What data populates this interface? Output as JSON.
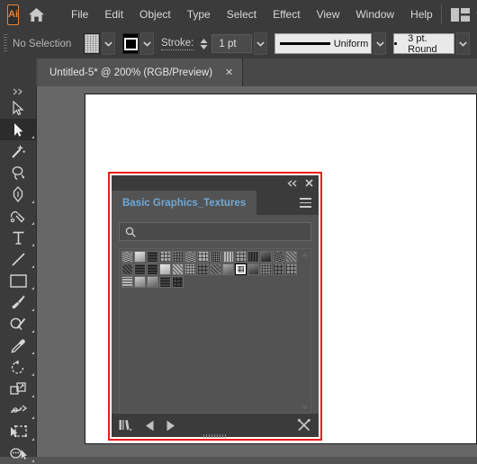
{
  "app": {
    "name": "Ai",
    "logo_color": "#e8833a",
    "home_icon": "home-icon",
    "workspace_icon": "workspace-switcher-icon"
  },
  "menubar": {
    "items": [
      {
        "label": "File"
      },
      {
        "label": "Edit"
      },
      {
        "label": "Object"
      },
      {
        "label": "Type"
      },
      {
        "label": "Select"
      },
      {
        "label": "Effect"
      },
      {
        "label": "View"
      },
      {
        "label": "Window"
      },
      {
        "label": "Help"
      }
    ]
  },
  "controlbar": {
    "selection_status": "No Selection",
    "fill_swatch": "noise-texture-swatch",
    "stroke_swatch": "stroke-color-swatch",
    "stroke_label": "Stroke:",
    "stroke_weight": "1 pt",
    "stroke_profile": "Uniform",
    "brush_definition": "3 pt. Round",
    "dropdown_icon": "chevron-down-icon"
  },
  "tabbar": {
    "document_title": "Untitled-5* @ 200% (RGB/Preview)",
    "close_glyph": "✕"
  },
  "toolbar": {
    "tools": [
      {
        "name": "selection-tool",
        "active": false,
        "has_flyout": false
      },
      {
        "name": "direct-selection-tool",
        "active": true,
        "has_flyout": true
      },
      {
        "name": "magic-wand-tool",
        "active": false,
        "has_flyout": false
      },
      {
        "name": "lasso-tool",
        "active": false,
        "has_flyout": false
      },
      {
        "name": "pen-tool",
        "active": false,
        "has_flyout": true
      },
      {
        "name": "curvature-tool",
        "active": false,
        "has_flyout": false
      },
      {
        "name": "type-tool",
        "active": false,
        "has_flyout": true
      },
      {
        "name": "line-segment-tool",
        "active": false,
        "has_flyout": true
      },
      {
        "name": "rectangle-tool",
        "active": false,
        "has_flyout": true
      },
      {
        "name": "paintbrush-tool",
        "active": false,
        "has_flyout": true
      },
      {
        "name": "shaper-tool",
        "active": false,
        "has_flyout": true
      },
      {
        "name": "eyedropper-tool",
        "active": false,
        "has_flyout": true
      },
      {
        "name": "rotate-tool",
        "active": false,
        "has_flyout": true
      },
      {
        "name": "scale-tool",
        "active": false,
        "has_flyout": true
      },
      {
        "name": "width-tool",
        "active": false,
        "has_flyout": true
      },
      {
        "name": "free-transform-tool",
        "active": false,
        "has_flyout": true
      },
      {
        "name": "shape-builder-tool",
        "active": false,
        "has_flyout": true
      }
    ]
  },
  "panel": {
    "highlight_color": "#ee1c1c",
    "tab_label": "Basic Graphics_Textures",
    "tab_label_color": "#6fa8d8",
    "collapse_icon": "double-chevron-left-icon",
    "close_icon": "close-icon",
    "menu_icon": "panel-menu-icon",
    "search": {
      "icon": "search-icon",
      "value": "",
      "placeholder": ""
    },
    "swatches": {
      "columns": 14,
      "total": 33,
      "selected_index": 23,
      "items": [
        {
          "name": "texture-swatch-1"
        },
        {
          "name": "texture-swatch-2"
        },
        {
          "name": "texture-swatch-3"
        },
        {
          "name": "texture-swatch-4"
        },
        {
          "name": "texture-swatch-5"
        },
        {
          "name": "texture-swatch-6"
        },
        {
          "name": "texture-swatch-7"
        },
        {
          "name": "texture-swatch-8"
        },
        {
          "name": "texture-swatch-9"
        },
        {
          "name": "texture-swatch-10"
        },
        {
          "name": "texture-swatch-11"
        },
        {
          "name": "texture-swatch-12"
        },
        {
          "name": "texture-swatch-13"
        },
        {
          "name": "texture-swatch-14"
        },
        {
          "name": "texture-swatch-15"
        },
        {
          "name": "texture-swatch-16"
        },
        {
          "name": "texture-swatch-17"
        },
        {
          "name": "texture-swatch-18"
        },
        {
          "name": "texture-swatch-19"
        },
        {
          "name": "texture-swatch-20"
        },
        {
          "name": "texture-swatch-21"
        },
        {
          "name": "texture-swatch-22"
        },
        {
          "name": "texture-swatch-23"
        },
        {
          "name": "texture-swatch-24"
        },
        {
          "name": "texture-swatch-25"
        },
        {
          "name": "texture-swatch-26"
        },
        {
          "name": "texture-swatch-27"
        },
        {
          "name": "texture-swatch-28"
        },
        {
          "name": "texture-swatch-29"
        },
        {
          "name": "texture-swatch-30"
        },
        {
          "name": "texture-swatch-31"
        },
        {
          "name": "texture-swatch-32"
        },
        {
          "name": "texture-swatch-33"
        }
      ]
    },
    "footer": {
      "libraries_icon": "libraries-menu-icon",
      "prev_icon": "previous-arrow-icon",
      "next_icon": "next-arrow-icon",
      "delete_icon": "delete-swatch-icon"
    }
  },
  "canvas": {
    "background": "#676767",
    "artboard_color": "#ffffff"
  }
}
